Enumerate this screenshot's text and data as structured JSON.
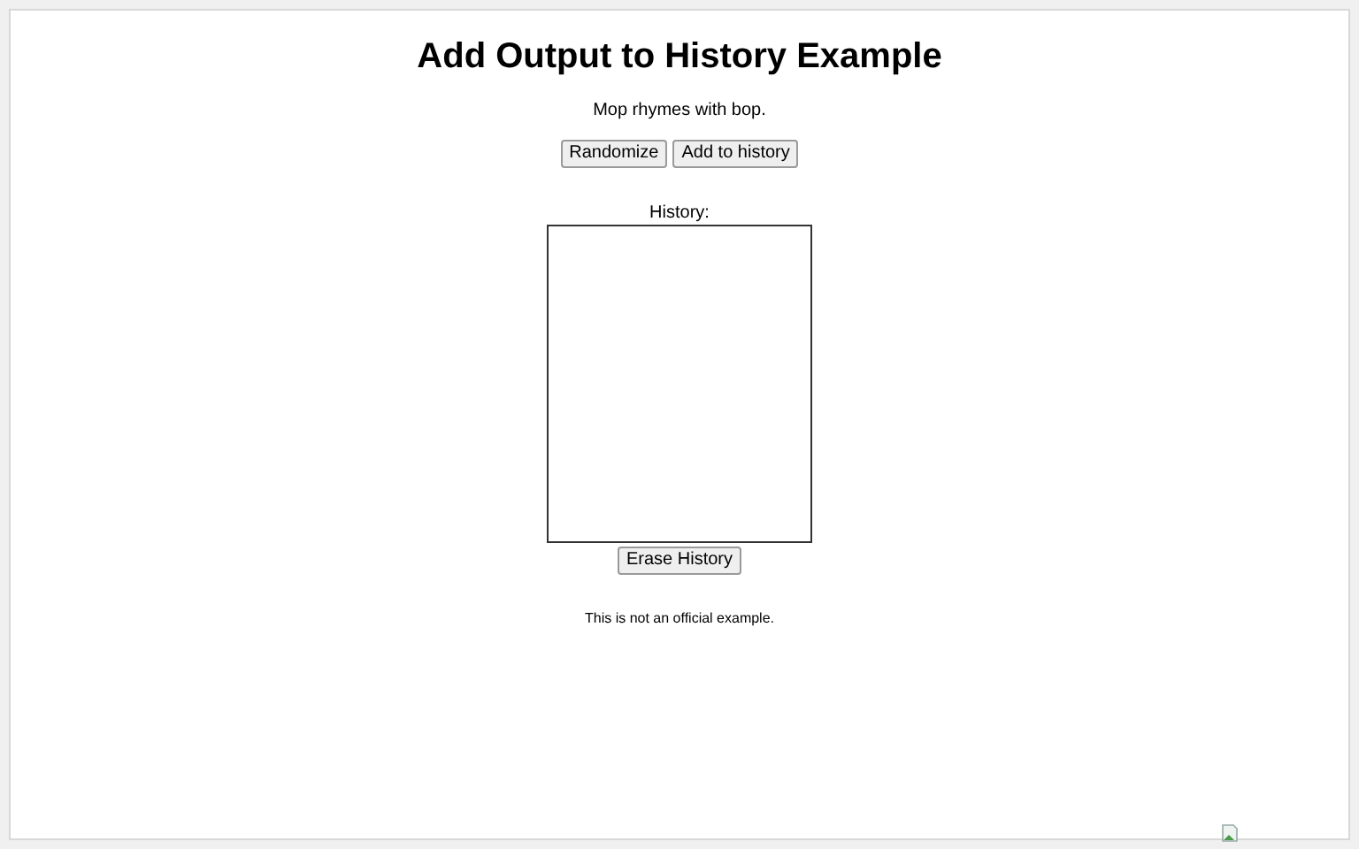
{
  "title": "Add Output to History Example",
  "output": "Mop rhymes with bop.",
  "buttons": [
    "Randomize",
    "Add to history"
  ],
  "history": {
    "label": "History:"
  },
  "erase_button": "Erase History",
  "note": "This is not an official example."
}
